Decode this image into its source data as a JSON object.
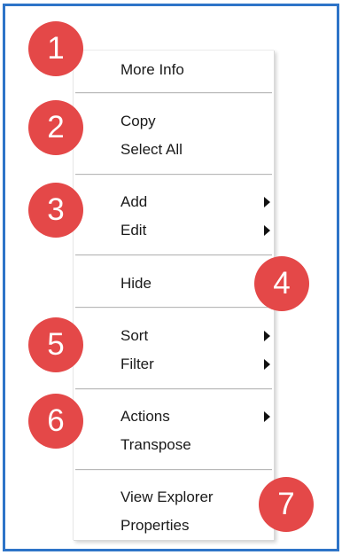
{
  "menu": {
    "items": [
      {
        "label": "More Info",
        "submenu": false
      },
      {
        "label": "Copy",
        "submenu": false
      },
      {
        "label": "Select All",
        "submenu": false
      },
      {
        "label": "Add",
        "submenu": true
      },
      {
        "label": "Edit",
        "submenu": true
      },
      {
        "label": "Hide",
        "submenu": false
      },
      {
        "label": "Sort",
        "submenu": true
      },
      {
        "label": "Filter",
        "submenu": true
      },
      {
        "label": "Actions",
        "submenu": true
      },
      {
        "label": "Transpose",
        "submenu": false
      },
      {
        "label": "View Explorer",
        "submenu": false
      },
      {
        "label": "Properties",
        "submenu": false
      }
    ]
  },
  "callouts": [
    "1",
    "2",
    "3",
    "4",
    "5",
    "6",
    "7"
  ],
  "colors": {
    "frame_border": "#2e74c8",
    "callout_fill": "#e44848",
    "callout_text": "#ffffff"
  }
}
